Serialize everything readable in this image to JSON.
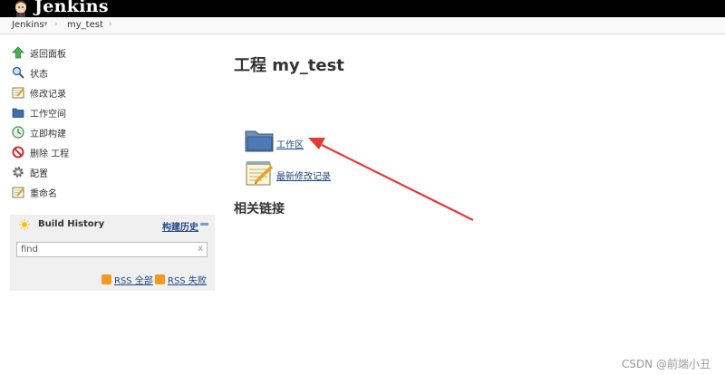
{
  "header": {
    "app_name": "Jenkins"
  },
  "breadcrumb": {
    "root": "Jenkins",
    "job": "my_test"
  },
  "sidebar": {
    "items": [
      {
        "label": "返回面板",
        "icon": "up-arrow-icon"
      },
      {
        "label": "状态",
        "icon": "search-icon"
      },
      {
        "label": "修改记录",
        "icon": "notepad-icon"
      },
      {
        "label": "工作空间",
        "icon": "folder-icon"
      },
      {
        "label": "立即构建",
        "icon": "clock-icon"
      },
      {
        "label": "删除 工程",
        "icon": "no-entry-icon"
      },
      {
        "label": "配置",
        "icon": "gear-icon"
      },
      {
        "label": "重命名",
        "icon": "notepad-icon"
      }
    ]
  },
  "build_history": {
    "title": "Build History",
    "trend_link": "构建历史",
    "search_value": "find",
    "clear": "x",
    "rss_all": "RSS 全部",
    "rss_failed": "RSS 失败"
  },
  "main": {
    "title": "工程 my_test",
    "workspace_link": "工作区",
    "changes_link": "最新修改记录",
    "related_heading": "相关链接"
  },
  "colors": {
    "topbar": "#000000",
    "link": "#204a87",
    "annotation_arrow": "#e53935"
  },
  "watermark": "CSDN @前端小丑"
}
